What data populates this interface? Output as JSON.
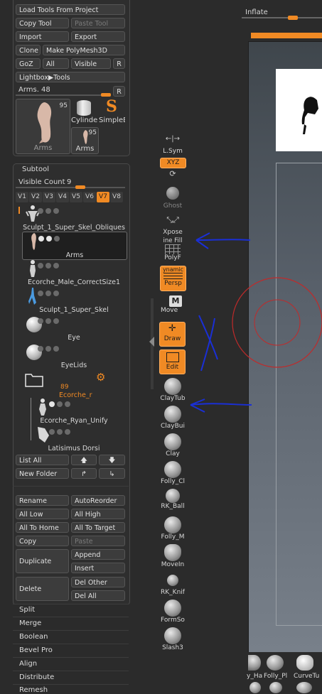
{
  "tool_panel": {
    "load_tools_from_project": "Load Tools From Project",
    "copy_tool": "Copy Tool",
    "paste_tool": "Paste Tool",
    "import": "Import",
    "export": "Export",
    "clone": "Clone",
    "make_polymesh3d": "Make PolyMesh3D",
    "goz": "GoZ",
    "all": "All",
    "visible": "Visible",
    "r": "R",
    "lightbox_tools": "Lightbox▶Tools",
    "arms_slider_label": "Arms.",
    "arms_slider_value": "48",
    "arms_slider_r": "R",
    "thumbs": [
      {
        "label": "Arms",
        "count": "95"
      },
      {
        "label": "Cylinde"
      },
      {
        "label": "SimpleB"
      },
      {
        "label": "Arms",
        "count": "95"
      }
    ]
  },
  "subtool": {
    "header": "Subtool",
    "visible_count_label": "Visible Count",
    "visible_count_value": "9",
    "visible_count_fraction": 0.6,
    "tabs": [
      "V1",
      "V2",
      "V3",
      "V4",
      "V5",
      "V6",
      "V7",
      "V8"
    ],
    "active_tab": "V7",
    "items": [
      {
        "name": "Sculpt_1_Super_Skel_Obliques"
      },
      {
        "name": "Arms"
      },
      {
        "name": "Ecorche_Male_CorrectSize1"
      },
      {
        "name": "Sculpt_1_Super_Skel"
      },
      {
        "name": "Eye"
      },
      {
        "name": "EyeLids"
      },
      {
        "name": "Ecorche_r",
        "count": "89"
      },
      {
        "name": "Ecorche_Ryan_Unify"
      },
      {
        "name": "Latisimus Dorsi"
      }
    ],
    "list_all": "List All",
    "new_folder": "New Folder",
    "rename": "Rename",
    "auto_reorder": "AutoReorder",
    "all_low": "All Low",
    "all_high": "All High",
    "all_to_home": "All To Home",
    "all_to_target": "All To Target",
    "copy": "Copy",
    "paste": "Paste",
    "duplicate": "Duplicate",
    "append": "Append",
    "insert": "Insert",
    "delete": "Delete",
    "del_other": "Del Other",
    "del_all": "Del All"
  },
  "subpalettes": [
    "Split",
    "Merge",
    "Boolean",
    "Bevel Pro",
    "Align",
    "Distribute",
    "Remesh"
  ],
  "shelf": {
    "lsym": "L.Sym",
    "xyz": "XYZ",
    "ghost": "Ghost",
    "xpose": "Xpose",
    "linefill": "ine Fill",
    "polyf": "PolyF",
    "dynamic": "ynamic",
    "persp": "Persp",
    "move": "Move",
    "draw": "Draw",
    "edit": "Edit",
    "brushes": [
      "ClayTub",
      "ClayBui",
      "Clay",
      "Folly_Cl",
      "RK_Ball",
      "Folly_M",
      "MoveIn",
      "RK_Knif",
      "FormSo",
      "Slash3"
    ]
  },
  "canvas": {
    "inflate_label": "Inflate",
    "inflate_fraction": 0.66,
    "bottom_brushes": [
      "y_Ha",
      "Folly_Pl",
      "CurveTu"
    ]
  },
  "colors": {
    "accent": "#f08a24",
    "annotation_blue": "#1a2fd6",
    "annotation_red": "#c02a2a"
  }
}
